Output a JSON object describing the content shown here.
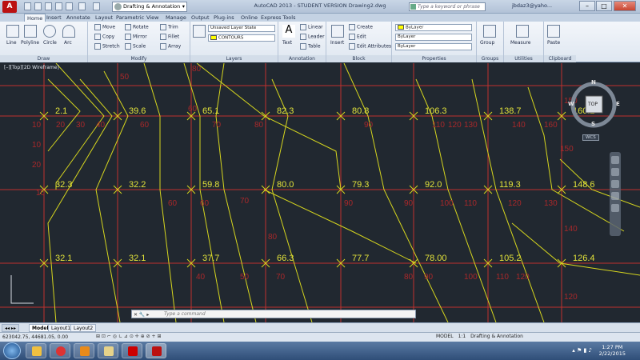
{
  "window": {
    "app_logo": "A",
    "workspace": "Drafting & Annotation",
    "title": "AutoCAD 2013 - STUDENT VERSION    Drawing2.dwg",
    "search_placeholder": "Type a keyword or phrase",
    "user": "jbdaz3@yaho...",
    "minimize": "–",
    "maximize": "□",
    "close": "✕"
  },
  "ribbon_tabs": [
    "Home",
    "Insert",
    "Annotate",
    "Layout",
    "Parametric",
    "View",
    "Manage",
    "Output",
    "Plug-ins",
    "Online",
    "Express Tools"
  ],
  "ribbon": {
    "draw": {
      "title": "Draw",
      "tools": [
        "Line",
        "Polyline",
        "Circle",
        "Arc"
      ]
    },
    "modify": {
      "title": "Modify",
      "tools": [
        "Move",
        "Rotate",
        "Trim",
        "Copy",
        "Mirror",
        "Fillet",
        "Stretch",
        "Scale",
        "Array"
      ]
    },
    "layers": {
      "title": "Layers",
      "layer_state": "Unsaved Layer State",
      "current_layer": "CONTOURS"
    },
    "annotation": {
      "title": "Annotation",
      "tools": [
        "Text",
        "Linear",
        "Leader",
        "Table"
      ]
    },
    "block": {
      "title": "Block",
      "tools": [
        "Insert",
        "Create",
        "Edit",
        "Edit Attributes"
      ]
    },
    "properties": {
      "title": "Properties",
      "color": "ByLayer",
      "linetype": "ByLayer",
      "lineweight": "ByLayer"
    },
    "groups": {
      "title": "Groups",
      "tools": [
        "Group"
      ]
    },
    "utilities": {
      "title": "Utilities",
      "tools": [
        "Measure"
      ]
    },
    "clipboard": {
      "title": "Clipboard",
      "tools": [
        "Paste"
      ]
    }
  },
  "viewport_label": "[–][Top][2D Wireframe]",
  "viewcube": {
    "north": "N",
    "south": "S",
    "east": "E",
    "west": "W",
    "face": "TOP",
    "wcs": "WCS"
  },
  "elevations": [
    {
      "label": "2.1",
      "x": 0,
      "y": 0
    },
    {
      "label": "39.6",
      "x": 1,
      "y": 0
    },
    {
      "label": "65.1",
      "x": 2,
      "y": 0
    },
    {
      "label": "82.3",
      "x": 3,
      "y": 0
    },
    {
      "label": "80.8",
      "x": 4,
      "y": 0
    },
    {
      "label": "106.3",
      "x": 5,
      "y": 0
    },
    {
      "label": "138.7",
      "x": 6,
      "y": 0
    },
    {
      "label": "160.2",
      "x": 7,
      "y": 0
    },
    {
      "label": "32.3",
      "x": 0,
      "y": 1
    },
    {
      "label": "32.2",
      "x": 1,
      "y": 1
    },
    {
      "label": "59.8",
      "x": 2,
      "y": 1
    },
    {
      "label": "80.0",
      "x": 3,
      "y": 1
    },
    {
      "label": "79.3",
      "x": 4,
      "y": 1
    },
    {
      "label": "92.0",
      "x": 5,
      "y": 1
    },
    {
      "label": "119.3",
      "x": 6,
      "y": 1
    },
    {
      "label": "148.6",
      "x": 7,
      "y": 1
    },
    {
      "label": "32.1",
      "x": 0,
      "y": 2
    },
    {
      "label": "32.1",
      "x": 1,
      "y": 2
    },
    {
      "label": "37.7",
      "x": 2,
      "y": 2
    },
    {
      "label": "66.3",
      "x": 3,
      "y": 2
    },
    {
      "label": "77.7",
      "x": 4,
      "y": 2
    },
    {
      "label": "78.00",
      "x": 5,
      "y": 2
    },
    {
      "label": "105.2",
      "x": 6,
      "y": 2
    },
    {
      "label": "126.4",
      "x": 7,
      "y": 2
    }
  ],
  "contour_labels": [
    "10",
    "20",
    "30",
    "40",
    "50",
    "60",
    "70",
    "80",
    "90",
    "100",
    "110",
    "120",
    "130",
    "140",
    "150",
    "160"
  ],
  "layout_tabs": [
    "Model",
    "Layout1",
    "Layout2"
  ],
  "command_placeholder": "Type a command",
  "status": {
    "coords": "623042.75, 44681.05, 0.00",
    "space": "MODEL",
    "scale": "1:1",
    "workspace": "Drafting & Annotation"
  },
  "clock": {
    "time": "1:27 PM",
    "date": "2/22/2015"
  }
}
